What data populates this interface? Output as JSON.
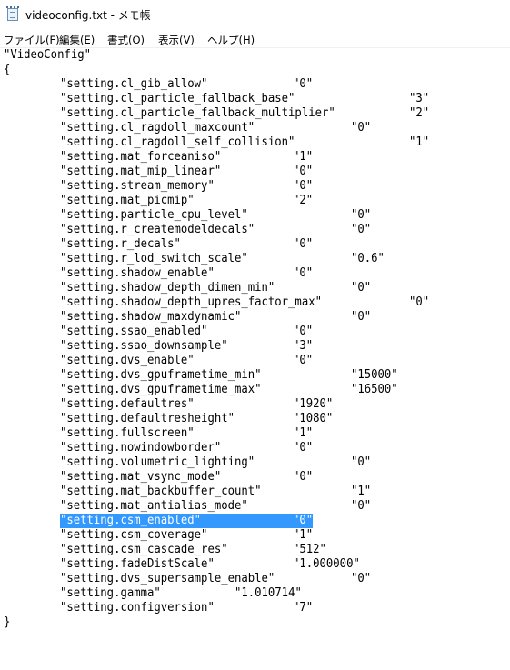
{
  "window": {
    "title": "videoconfig.txt - メモ帳",
    "icon": "notepad-icon"
  },
  "menu": [
    "ファイル(F)",
    "編集(E)",
    "書式(O)",
    "表示(V)",
    "ヘルプ(H)"
  ],
  "document": {
    "header": "\"VideoConfig\"",
    "open_brace": "{",
    "close_brace": "}",
    "settings": [
      {
        "key": "\"setting.cl_gib_allow\"",
        "sep": "\t\t",
        "value": "\"0\""
      },
      {
        "key": "\"setting.cl_particle_fallback_base\"",
        "sep": "\t\t",
        "value": "\"3\""
      },
      {
        "key": "\"setting.cl_particle_fallback_multiplier\"",
        "sep": "\t\t",
        "value": "\"2\""
      },
      {
        "key": "\"setting.cl_ragdoll_maxcount\"",
        "sep": "\t\t",
        "value": "\"0\""
      },
      {
        "key": "\"setting.cl_ragdoll_self_collision\"",
        "sep": "\t\t",
        "value": "\"1\""
      },
      {
        "key": "\"setting.mat_forceaniso\"",
        "sep": "\t\t",
        "value": "\"1\""
      },
      {
        "key": "\"setting.mat_mip_linear\"",
        "sep": "\t\t",
        "value": "\"0\""
      },
      {
        "key": "\"setting.stream_memory\"",
        "sep": "\t\t",
        "value": "\"0\""
      },
      {
        "key": "\"setting.mat_picmip\"",
        "sep": "\t\t",
        "value": "\"2\""
      },
      {
        "key": "\"setting.particle_cpu_level\"",
        "sep": "\t\t",
        "value": "\"0\""
      },
      {
        "key": "\"setting.r_createmodeldecals\"",
        "sep": "\t\t",
        "value": "\"0\""
      },
      {
        "key": "\"setting.r_decals\"",
        "sep": "\t\t",
        "value": "\"0\""
      },
      {
        "key": "\"setting.r_lod_switch_scale\"",
        "sep": "\t\t",
        "value": "\"0.6\""
      },
      {
        "key": "\"setting.shadow_enable\"",
        "sep": "\t\t",
        "value": "\"0\""
      },
      {
        "key": "\"setting.shadow_depth_dimen_min\"",
        "sep": "\t\t",
        "value": "\"0\""
      },
      {
        "key": "\"setting.shadow_depth_upres_factor_max\"",
        "sep": "\t\t",
        "value": "\"0\""
      },
      {
        "key": "\"setting.shadow_maxdynamic\"",
        "sep": "\t\t",
        "value": "\"0\""
      },
      {
        "key": "\"setting.ssao_enabled\"",
        "sep": "\t\t",
        "value": "\"0\""
      },
      {
        "key": "\"setting.ssao_downsample\"",
        "sep": "\t\t",
        "value": "\"3\""
      },
      {
        "key": "\"setting.dvs_enable\"",
        "sep": "\t\t",
        "value": "\"0\""
      },
      {
        "key": "\"setting.dvs_gpuframetime_min\"",
        "sep": "\t\t",
        "value": "\"15000\""
      },
      {
        "key": "\"setting.dvs_gpuframetime_max\"",
        "sep": "\t\t",
        "value": "\"16500\""
      },
      {
        "key": "\"setting.defaultres\"",
        "sep": "\t\t",
        "value": "\"1920\""
      },
      {
        "key": "\"setting.defaultresheight\"",
        "sep": "\t\t",
        "value": "\"1080\""
      },
      {
        "key": "\"setting.fullscreen\"",
        "sep": "\t\t",
        "value": "\"1\""
      },
      {
        "key": "\"setting.nowindowborder\"",
        "sep": "\t\t",
        "value": "\"0\""
      },
      {
        "key": "\"setting.volumetric_lighting\"",
        "sep": "\t\t",
        "value": "\"0\""
      },
      {
        "key": "\"setting.mat_vsync_mode\"",
        "sep": "\t\t",
        "value": "\"0\""
      },
      {
        "key": "\"setting.mat_backbuffer_count\"",
        "sep": "\t\t",
        "value": "\"1\""
      },
      {
        "key": "\"setting.mat_antialias_mode\"",
        "sep": "\t\t",
        "value": "\"0\""
      },
      {
        "key": "\"setting.csm_enabled\"",
        "sep": "\t\t",
        "value": "\"0\"",
        "selected": true
      },
      {
        "key": "\"setting.csm_coverage\"",
        "sep": "\t\t",
        "value": "\"1\""
      },
      {
        "key": "\"setting.csm_cascade_res\"",
        "sep": "\t\t",
        "value": "\"512\""
      },
      {
        "key": "\"setting.fadeDistScale\"",
        "sep": "\t\t",
        "value": "\"1.000000\""
      },
      {
        "key": "\"setting.dvs_supersample_enable\"",
        "sep": "\t\t",
        "value": "\"0\""
      },
      {
        "key": "\"setting.gamma\"",
        "sep": "\t\t",
        "value": "\"1.010714\""
      },
      {
        "key": "\"setting.configversion\"",
        "sep": "\t\t",
        "value": "\"7\""
      }
    ]
  },
  "colors": {
    "selection": "#3399ff",
    "background": "#ffffff",
    "text": "#000000"
  }
}
